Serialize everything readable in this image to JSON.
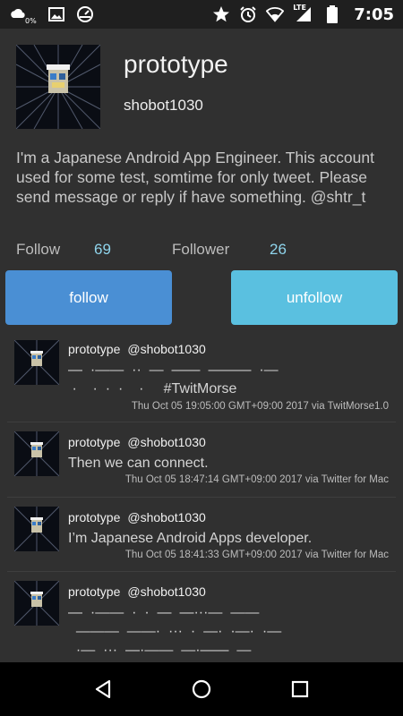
{
  "status_bar": {
    "time": "7:05",
    "network_label": "LTE",
    "data_label": "0%",
    "icons": [
      "cloud-icon",
      "image-icon",
      "speedometer-icon",
      "star-icon",
      "alarm-icon",
      "wifi-icon",
      "signal-icon",
      "battery-icon"
    ]
  },
  "profile": {
    "name": "prototype",
    "screen_name": "shobot1030",
    "bio": "I'm a Japanese Android App Engineer. This account used for some test, somtime for only tweet.  Please send message or reply if have something. @shtr_t",
    "follow_label": "Follow",
    "follow_count": "69",
    "follower_label": "Follower",
    "follower_count": "26"
  },
  "buttons": {
    "follow": "follow",
    "unfollow": "unfollow"
  },
  "tweets": [
    {
      "name": "prototype",
      "screen_name": "@shobot1030",
      "text": "—  ·——  ··  —  ——  ———  ·—\n ·    ·  ·  ·    ·     #TwitMorse",
      "meta": "Thu Oct 05 19:05:00 GMT+09:00 2017 via TwitMorse1.0"
    },
    {
      "name": "prototype",
      "screen_name": "@shobot1030",
      "text": "Then we can connect.",
      "meta": "Thu Oct 05 18:47:14 GMT+09:00 2017 via Twitter for Mac"
    },
    {
      "name": "prototype",
      "screen_name": "@shobot1030",
      "text": "I’m Japanese Android Apps developer.",
      "meta": "Thu Oct 05 18:41:33 GMT+09:00 2017 via Twitter for Mac"
    },
    {
      "name": "prototype",
      "screen_name": "@shobot1030",
      "text": "—  ·——  ·  ·  —  —···—  ——\n  ———  ——·  ···  ·  —·  ·—·  ·—\n  ·—  ···  —·——  —·——  —",
      "meta": ""
    }
  ],
  "colors": {
    "background": "#303030",
    "follow_button": "#4a8fd4",
    "unfollow_button": "#5ac0e0",
    "count_text": "#8fd4ec"
  }
}
